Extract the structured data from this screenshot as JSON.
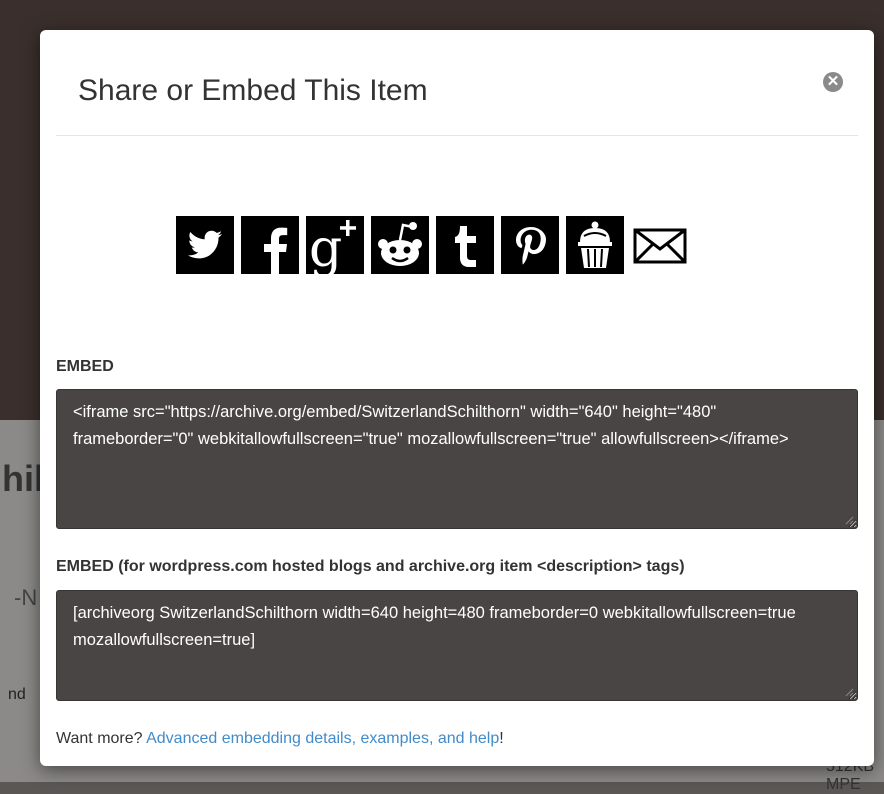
{
  "modal": {
    "title": "Share or Embed This Item",
    "close_symbol": "✕"
  },
  "share_buttons": [
    {
      "icon": "twitter-icon"
    },
    {
      "icon": "facebook-icon"
    },
    {
      "icon": "google-plus-icon"
    },
    {
      "icon": "reddit-icon"
    },
    {
      "icon": "tumblr-icon"
    },
    {
      "icon": "pinterest-icon"
    },
    {
      "icon": "archive-icon"
    },
    {
      "icon": "email-icon"
    }
  ],
  "embed": {
    "label": "EMBED",
    "code": "<iframe src=\"https://archive.org/embed/SwitzerlandSchilthorn\" width=\"640\" height=\"480\" frameborder=\"0\" webkitallowfullscreen=\"true\" mozallowfullscreen=\"true\" allowfullscreen></iframe>"
  },
  "embed_wordpress": {
    "label": "EMBED (for wordpress.com hosted blogs and archive.org item <description> tags)",
    "code": "[archiveorg SwitzerlandSchilthorn width=640 height=480 frameborder=0 webkitallowfullscreen=true mozallowfullscreen=true]"
  },
  "footer": {
    "prefix": "Want more? ",
    "link_text": "Advanced embedding details, examples, and help",
    "suffix": "!"
  },
  "colors": {
    "code_box_bg": "#4a4545",
    "link": "#428bca",
    "icon_bg": "#000000"
  }
}
